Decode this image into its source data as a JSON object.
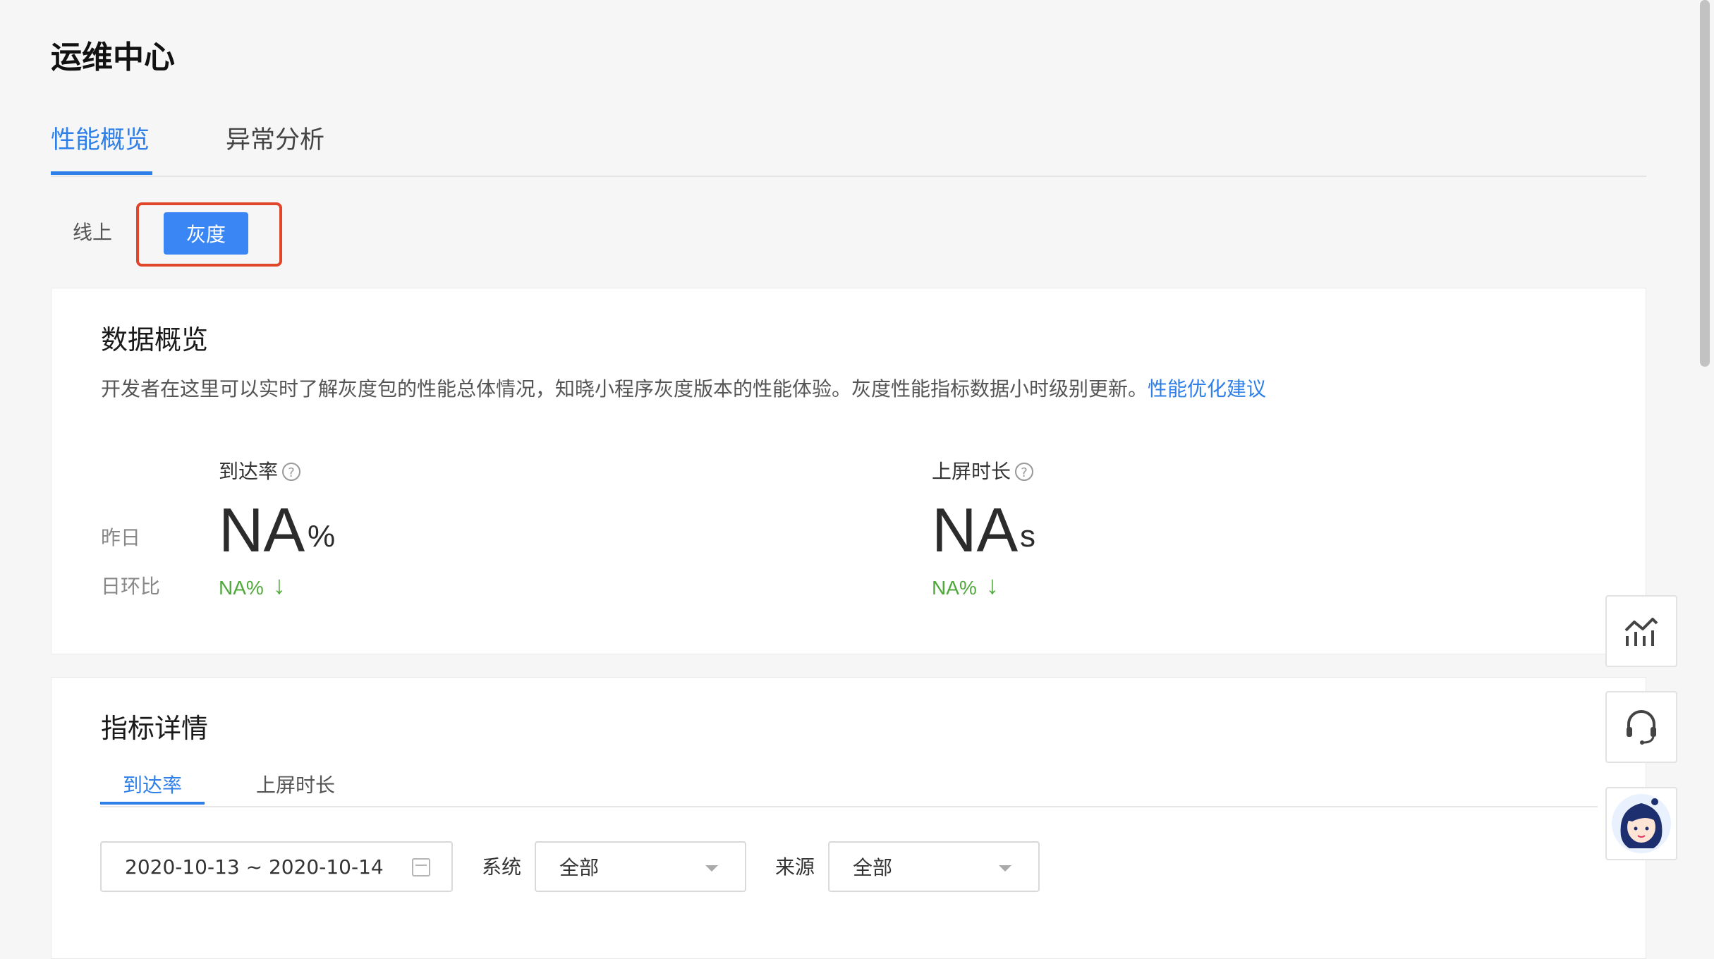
{
  "header": {
    "title": "运维中心"
  },
  "tabs": [
    {
      "label": "性能概览",
      "active": true
    },
    {
      "label": "异常分析",
      "active": false
    }
  ],
  "env_switch": {
    "online_label": "线上",
    "gray_label": "灰度",
    "selected": "灰度"
  },
  "overview": {
    "title": "数据概览",
    "description": "开发者在这里可以实时了解灰度包的性能总体情况，知晓小程序灰度版本的性能体验。灰度性能指标数据小时级别更新。",
    "link_text": "性能优化建议",
    "row_labels": {
      "yesterday": "昨日",
      "day_over_day": "日环比"
    },
    "metrics": [
      {
        "label": "到达率",
        "value": "NA",
        "unit": "%",
        "change": "NA%",
        "trend_icon": "arrow-down-icon"
      },
      {
        "label": "上屏时长",
        "value": "NA",
        "unit": "s",
        "change": "NA%",
        "trend_icon": "arrow-down-icon"
      }
    ]
  },
  "details": {
    "title": "指标详情",
    "subtabs": [
      {
        "label": "到达率",
        "active": true
      },
      {
        "label": "上屏时长",
        "active": false
      }
    ],
    "date_range": "2020-10-13 ~ 2020-10-14",
    "filters": [
      {
        "label": "系统",
        "value": "全部"
      },
      {
        "label": "来源",
        "value": "全部"
      }
    ]
  },
  "floating_buttons": [
    "chart-icon",
    "headset-icon",
    "avatar"
  ],
  "colors": {
    "accent": "#2f7fe8",
    "highlight_border": "#e1462a",
    "trend_green": "#4fa93a"
  }
}
